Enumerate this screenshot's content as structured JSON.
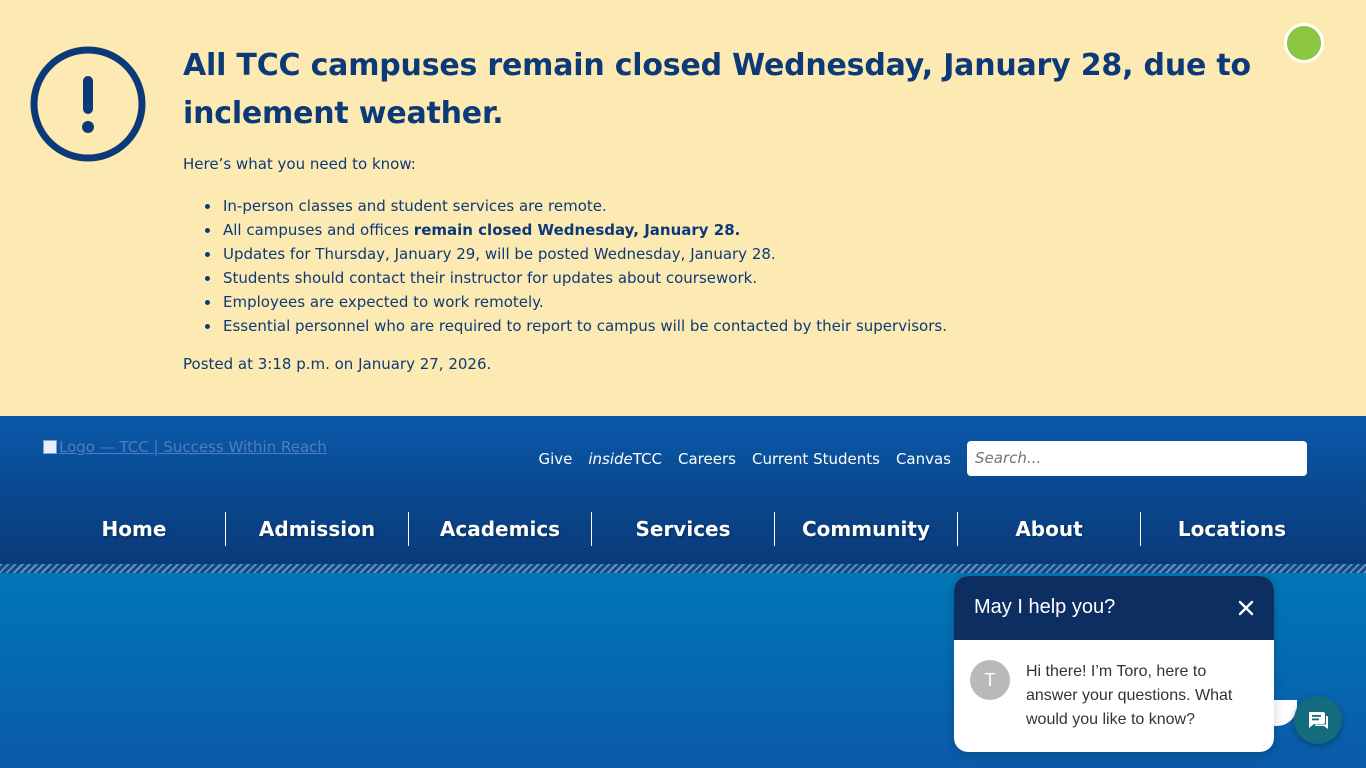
{
  "alert": {
    "icon": "exclamation-circle-icon",
    "title": "All TCC campuses remain closed Wednesday, January 28, due to inclement weather.",
    "intro": "Here’s what you need to know:",
    "items": [
      {
        "text": "In-person classes and student services are remote.",
        "bold": ""
      },
      {
        "text": "All campuses and offices ",
        "bold": "remain closed Wednesday, January 28."
      },
      {
        "text": "Updates for Thursday, January 29, will be posted Wednesday, January 28.",
        "bold": ""
      },
      {
        "text": "Students should contact their instructor for updates about coursework.",
        "bold": ""
      },
      {
        "text": "Employees are expected to work remotely.",
        "bold": ""
      },
      {
        "text": "Essential personnel who are required to report to campus will be contacted by their supervisors.",
        "bold": ""
      }
    ],
    "posted": "Posted at 3:18 p.m. on January 27, 2026."
  },
  "header": {
    "logo_alt": "Logo — TCC | Success Within Reach",
    "utility": {
      "give": "Give",
      "inside_prefix": "inside",
      "inside_suffix": "TCC",
      "careers": "Careers",
      "current_students": "Current Students",
      "canvas": "Canvas"
    },
    "search_placeholder": "Search...",
    "nav": [
      "Home",
      "Admission",
      "Academics",
      "Services",
      "Community",
      "About",
      "Locations"
    ]
  },
  "chat": {
    "title": "May I help you?",
    "avatar_letter": "T",
    "message": "Hi there! I’m Toro, here to answer your questions. What would you like to know?",
    "fab_icon": "chat-bubble-icon",
    "close_icon": "close-icon"
  },
  "colors": {
    "alert_bg": "#fdeab2",
    "alert_text": "#0c3a78",
    "header_blue": "#0a4a92",
    "search_button": "#8cc63f",
    "chat_header": "#0d2e60",
    "chat_fab": "#136b7d"
  }
}
